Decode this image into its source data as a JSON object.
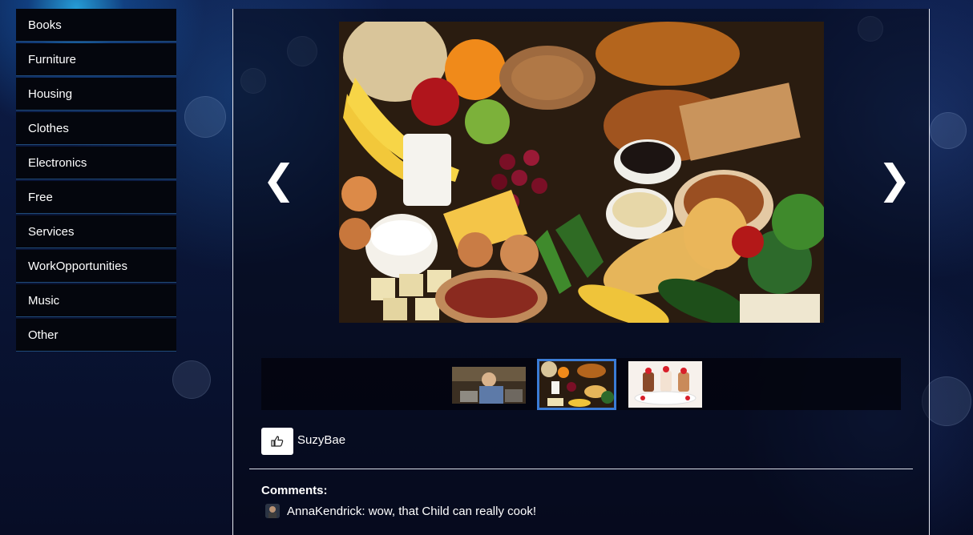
{
  "sidebar": {
    "items": [
      {
        "label": "Books"
      },
      {
        "label": "Furniture"
      },
      {
        "label": "Housing"
      },
      {
        "label": "Clothes"
      },
      {
        "label": "Electronics"
      },
      {
        "label": "Free"
      },
      {
        "label": "Services"
      },
      {
        "label": "WorkOpportunities"
      },
      {
        "label": "Music"
      },
      {
        "label": "Other"
      }
    ]
  },
  "carousel": {
    "prev_arrow": "❮",
    "next_arrow": "❯",
    "selected_thumbnail": 2,
    "thumbnail_count": 3,
    "thumbnail_selected_border_color": "#3a7bd5"
  },
  "like": {
    "icon": "thumbs-up-icon",
    "user": "SuzyBae"
  },
  "comments": {
    "label": "Comments:",
    "items": [
      {
        "text": "AnnaKendrick: wow, that Child can really cook!"
      }
    ]
  }
}
